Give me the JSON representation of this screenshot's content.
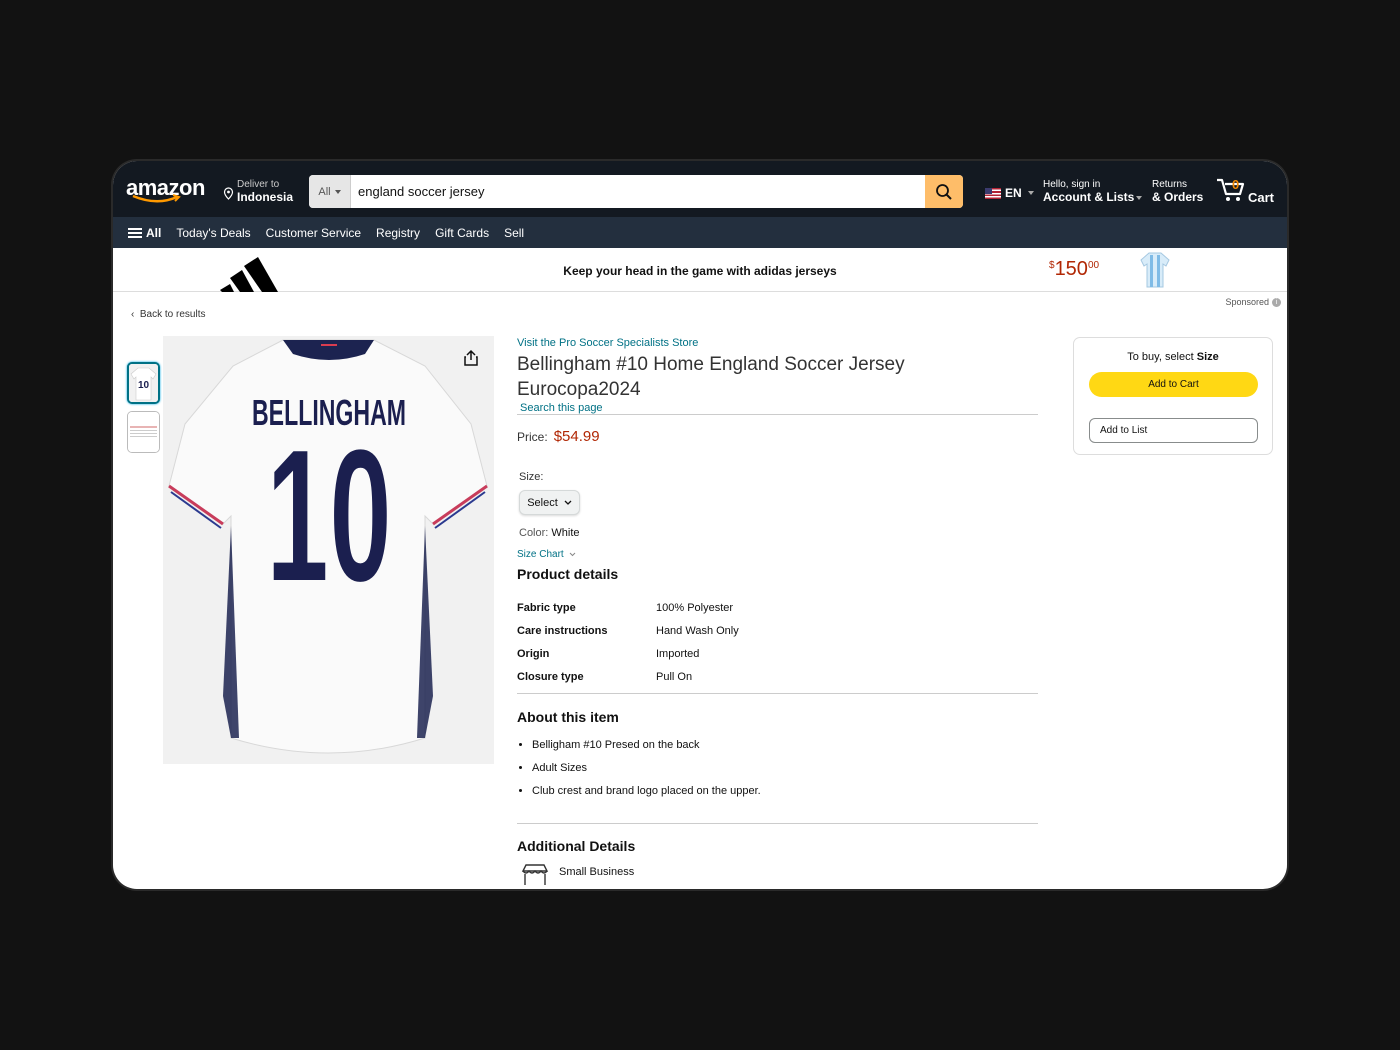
{
  "nav": {
    "logo": "amazon",
    "deliver_line1": "Deliver to",
    "deliver_line2": "Indonesia",
    "search_category": "All",
    "search_value": "england soccer jersey",
    "lang": "EN",
    "account_line1": "Hello, sign in",
    "account_line2": "Account & Lists",
    "returns_line1": "Returns",
    "returns_line2": "& Orders",
    "cart_count": "0",
    "cart_label": "Cart"
  },
  "subnav": {
    "all": "All",
    "items": [
      "Today's Deals",
      "Customer Service",
      "Registry",
      "Gift Cards",
      "Sell"
    ]
  },
  "banner": {
    "tagline": "Keep your head in the game with adidas jerseys",
    "price_symbol": "$",
    "price_whole": "150",
    "price_fraction": "00",
    "sponsored": "Sponsored"
  },
  "back_link": "Back to results",
  "product": {
    "store_link": "Visit the Pro Soccer Specialists Store",
    "title": "Bellingham #10 Home England Soccer Jersey Eurocopa2024",
    "search_page": "Search this page",
    "price_label": "Price:",
    "price": "$54.99",
    "size_label": "Size:",
    "size_select": "Select",
    "color_label": "Color:",
    "color_value": "White",
    "size_chart": "Size Chart",
    "jersey_name": "BELLINGHAM",
    "jersey_number": "10"
  },
  "product_details": {
    "heading": "Product details",
    "rows": [
      {
        "k": "Fabric type",
        "v": "100% Polyester"
      },
      {
        "k": "Care instructions",
        "v": "Hand Wash Only"
      },
      {
        "k": "Origin",
        "v": "Imported"
      },
      {
        "k": "Closure type",
        "v": "Pull On"
      }
    ]
  },
  "about": {
    "heading": "About this item",
    "bullets": [
      "Belligham #10 Presed on the back",
      "Adult Sizes",
      "Club crest and brand logo placed on the upper."
    ]
  },
  "additional": {
    "heading": "Additional Details",
    "small_business": "Small Business"
  },
  "buybox": {
    "head_prefix": "To buy, select",
    "head_bold": "Size",
    "add_to_cart": "Add to Cart",
    "add_to_list": "Add to List"
  },
  "colors": {
    "nav_bg": "#131921",
    "subnav_bg": "#232f3e",
    "search_button": "#febd69",
    "link": "#007185",
    "price": "#b12704",
    "cart_button": "#ffd814"
  }
}
